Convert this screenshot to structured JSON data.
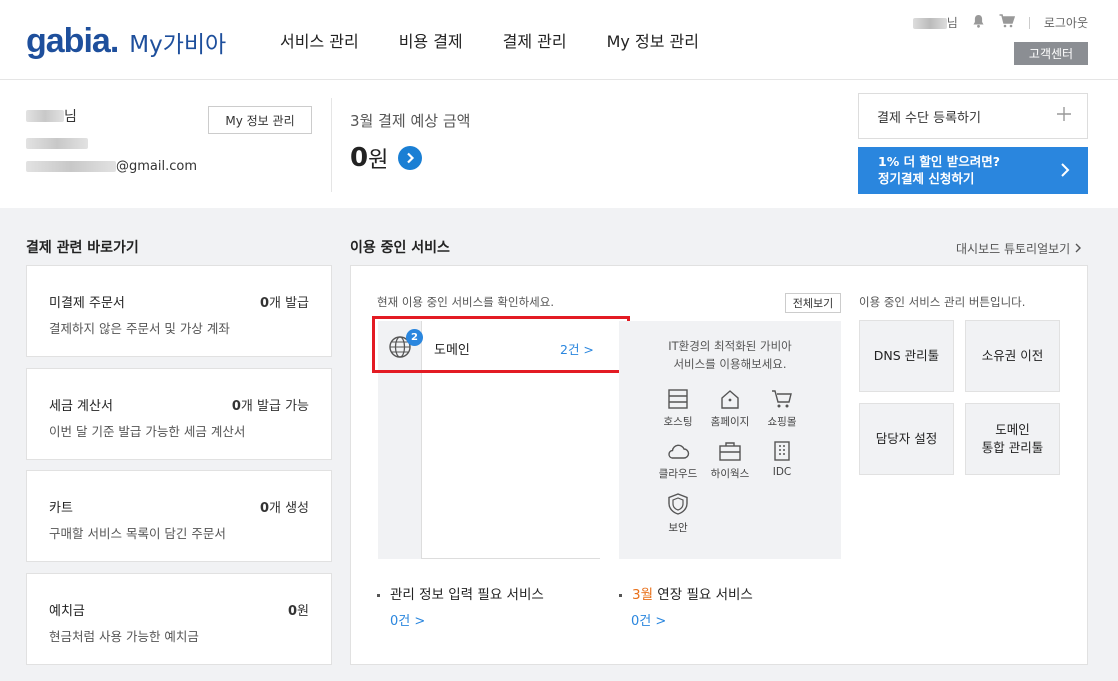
{
  "header": {
    "logo_word": "gabia",
    "logo_dot": ".",
    "logo_sub": "My가비아",
    "nav": [
      "서비스 관리",
      "비용 결제",
      "결제 관리",
      "My 정보 관리"
    ],
    "user_suffix": "님",
    "logout": "로그아웃",
    "cs_center": "고객센터"
  },
  "summary": {
    "user_suffix": "님",
    "email_suffix": "@gmail.com",
    "myinfo_button": "My 정보 관리",
    "pay_label": "3월 결제 예상 금액",
    "pay_amount": "0",
    "pay_unit": "원",
    "register_payment": "결제 수단 등록하기",
    "promo_line1": "1% 더 할인 받으려면?",
    "promo_line2": "정기결제 신청하기"
  },
  "left": {
    "title": "결제 관련 바로가기",
    "cards": [
      {
        "title": "미결제 주문서",
        "num": "0",
        "unit": "개 발급",
        "desc": "결제하지 않은 주문서 및 가상 계좌"
      },
      {
        "title": "세금 계산서",
        "num": "0",
        "unit": "개 발급 가능",
        "desc": "이번 달 기준 발급 가능한 세금 계산서"
      },
      {
        "title": "카트",
        "num": "0",
        "unit": "개 생성",
        "desc": "구매할 서비스 목록이 담긴 주문서"
      },
      {
        "title": "예치금",
        "num": "0",
        "unit": "원",
        "desc": "현금처럼 사용 가능한 예치금"
      }
    ]
  },
  "services": {
    "title": "이용 중인 서비스",
    "tutorial_link": "대시보드 튜토리얼보기",
    "hint": "현재 이용 중인 서비스를 확인하세요.",
    "view_all": "전체보기",
    "domain": {
      "label": "도메인",
      "count": "2건 >",
      "badge": "2"
    },
    "promo_line1": "IT환경의 최적화된 가비아",
    "promo_line2": "서비스를 이용해보세요.",
    "products": [
      "호스팅",
      "홈페이지",
      "쇼핑몰",
      "클라우드",
      "하이웍스",
      "IDC",
      "보안"
    ],
    "mgmt_hint": "이용 중인 서비스 관리 버튼입니다.",
    "tools": [
      "DNS 관리툴",
      "소유권 이전",
      "담당자 설정",
      "도메인\n통합 관리툴"
    ],
    "bottom_left_label": "관리 정보 입력 필요 서비스",
    "bottom_left_count": "0건 >",
    "bottom_right_month": "3월",
    "bottom_right_label": " 연장 필요 서비스",
    "bottom_right_count": "0건 >"
  },
  "colors": {
    "brand": "#1e4f9c",
    "accent": "#2a86de",
    "highlight": "#e31b23",
    "orange": "#e8701a"
  }
}
